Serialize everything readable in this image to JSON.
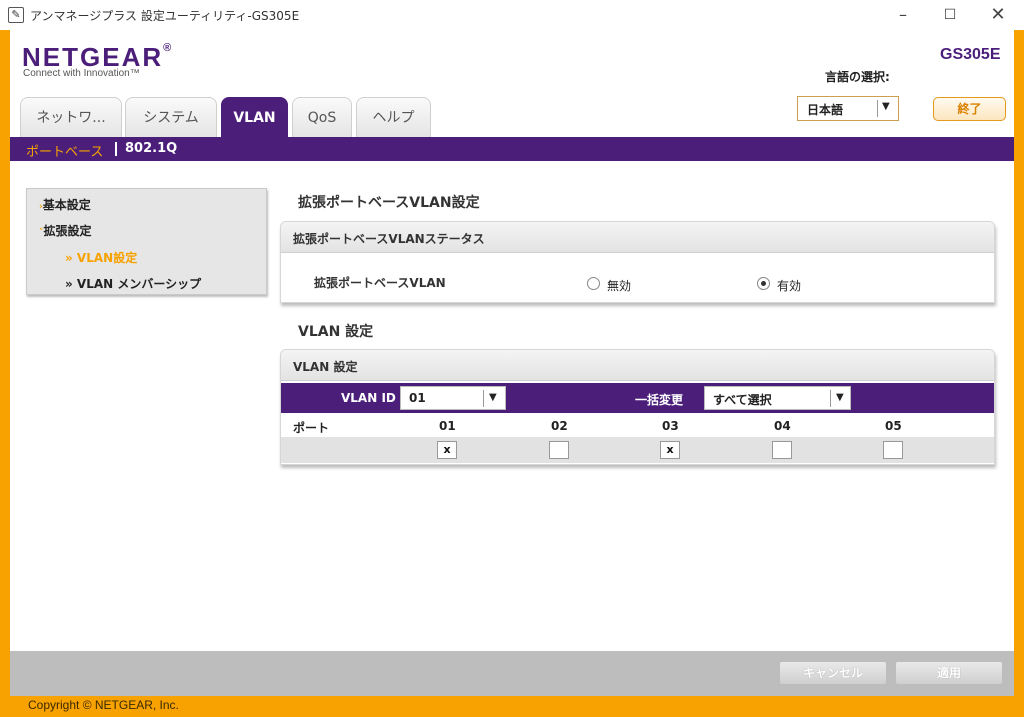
{
  "window": {
    "app_icon": "wrench-icon",
    "title": "アンマネージプラス 設定ユーティリティ-GS305E",
    "minimize": "–",
    "maximize": "☐",
    "close": "✕"
  },
  "header": {
    "logo": "NETGEAR",
    "logo_mark": "®",
    "tagline": "Connect with Innovation™",
    "model": "GS305E",
    "language_label": "言語の選択:",
    "language_value": "日本語",
    "exit_label": "終了"
  },
  "tabs": [
    {
      "label": "ネットワ...",
      "active": false
    },
    {
      "label": "システム",
      "active": false
    },
    {
      "label": "VLAN",
      "active": true
    },
    {
      "label": "QoS",
      "active": false
    },
    {
      "label": "ヘルプ",
      "active": false
    }
  ],
  "subnav": {
    "items": [
      {
        "label": "ポートベース",
        "active": true
      },
      {
        "label": "802.1Q",
        "active": false
      }
    ]
  },
  "sidebar": {
    "items": [
      {
        "label": "基本設定",
        "marker": "›"
      },
      {
        "label": "拡張設定",
        "marker": "˅"
      }
    ],
    "subitems": [
      {
        "label": "» VLAN設定",
        "active": true
      },
      {
        "label": "» VLAN メンバーシップ",
        "active": false
      }
    ]
  },
  "status_section": {
    "title": "拡張ポートベースVLAN設定",
    "panel_title": "拡張ポートベースVLANステータス",
    "row_label": "拡張ポートベースVLAN",
    "option_disabled": "無効",
    "option_enabled": "有効",
    "selected": "有効"
  },
  "vlan_section": {
    "title": "VLAN 設定",
    "panel_title": "VLAN 設定",
    "vlan_id_label": "VLAN ID",
    "vlan_id_value": "01",
    "bulk_label": "一括変更",
    "bulk_value": "すべて選択",
    "port_label": "ポート",
    "ports": [
      {
        "label": "01",
        "checked": true,
        "mark": "x"
      },
      {
        "label": "02",
        "checked": false,
        "mark": ""
      },
      {
        "label": "03",
        "checked": true,
        "mark": "x"
      },
      {
        "label": "04",
        "checked": false,
        "mark": ""
      },
      {
        "label": "05",
        "checked": false,
        "mark": ""
      }
    ]
  },
  "actions": {
    "cancel_label": "キャンセル",
    "apply_label": "適用"
  },
  "footer": {
    "copyright": "Copyright © NETGEAR, Inc."
  },
  "colors": {
    "brand_purple": "#4b1e7a",
    "accent_orange": "#f7a200",
    "disabled_gray": "#bdbdbd"
  }
}
